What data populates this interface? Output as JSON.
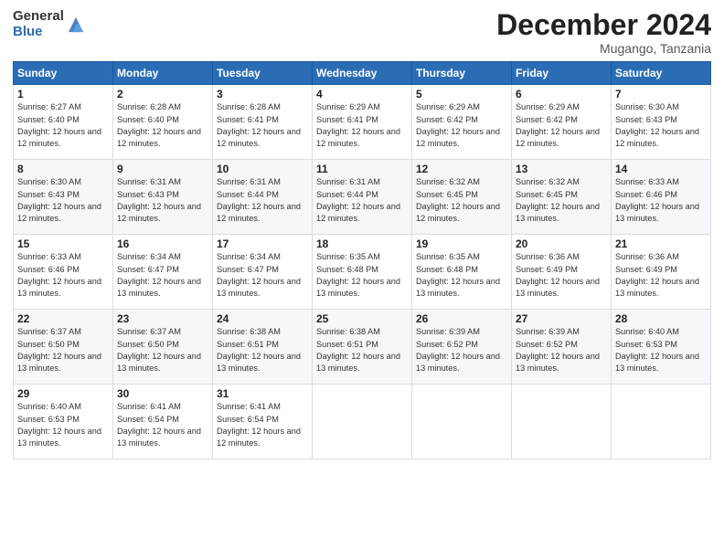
{
  "logo": {
    "general": "General",
    "blue": "Blue"
  },
  "title": "December 2024",
  "location": "Mugango, Tanzania",
  "days_of_week": [
    "Sunday",
    "Monday",
    "Tuesday",
    "Wednesday",
    "Thursday",
    "Friday",
    "Saturday"
  ],
  "weeks": [
    [
      {
        "day": "1",
        "sunrise": "6:27 AM",
        "sunset": "6:40 PM",
        "daylight": "12 hours and 12 minutes."
      },
      {
        "day": "2",
        "sunrise": "6:28 AM",
        "sunset": "6:40 PM",
        "daylight": "12 hours and 12 minutes."
      },
      {
        "day": "3",
        "sunrise": "6:28 AM",
        "sunset": "6:41 PM",
        "daylight": "12 hours and 12 minutes."
      },
      {
        "day": "4",
        "sunrise": "6:29 AM",
        "sunset": "6:41 PM",
        "daylight": "12 hours and 12 minutes."
      },
      {
        "day": "5",
        "sunrise": "6:29 AM",
        "sunset": "6:42 PM",
        "daylight": "12 hours and 12 minutes."
      },
      {
        "day": "6",
        "sunrise": "6:29 AM",
        "sunset": "6:42 PM",
        "daylight": "12 hours and 12 minutes."
      },
      {
        "day": "7",
        "sunrise": "6:30 AM",
        "sunset": "6:43 PM",
        "daylight": "12 hours and 12 minutes."
      }
    ],
    [
      {
        "day": "8",
        "sunrise": "6:30 AM",
        "sunset": "6:43 PM",
        "daylight": "12 hours and 12 minutes."
      },
      {
        "day": "9",
        "sunrise": "6:31 AM",
        "sunset": "6:43 PM",
        "daylight": "12 hours and 12 minutes."
      },
      {
        "day": "10",
        "sunrise": "6:31 AM",
        "sunset": "6:44 PM",
        "daylight": "12 hours and 12 minutes."
      },
      {
        "day": "11",
        "sunrise": "6:31 AM",
        "sunset": "6:44 PM",
        "daylight": "12 hours and 12 minutes."
      },
      {
        "day": "12",
        "sunrise": "6:32 AM",
        "sunset": "6:45 PM",
        "daylight": "12 hours and 12 minutes."
      },
      {
        "day": "13",
        "sunrise": "6:32 AM",
        "sunset": "6:45 PM",
        "daylight": "12 hours and 13 minutes."
      },
      {
        "day": "14",
        "sunrise": "6:33 AM",
        "sunset": "6:46 PM",
        "daylight": "12 hours and 13 minutes."
      }
    ],
    [
      {
        "day": "15",
        "sunrise": "6:33 AM",
        "sunset": "6:46 PM",
        "daylight": "12 hours and 13 minutes."
      },
      {
        "day": "16",
        "sunrise": "6:34 AM",
        "sunset": "6:47 PM",
        "daylight": "12 hours and 13 minutes."
      },
      {
        "day": "17",
        "sunrise": "6:34 AM",
        "sunset": "6:47 PM",
        "daylight": "12 hours and 13 minutes."
      },
      {
        "day": "18",
        "sunrise": "6:35 AM",
        "sunset": "6:48 PM",
        "daylight": "12 hours and 13 minutes."
      },
      {
        "day": "19",
        "sunrise": "6:35 AM",
        "sunset": "6:48 PM",
        "daylight": "12 hours and 13 minutes."
      },
      {
        "day": "20",
        "sunrise": "6:36 AM",
        "sunset": "6:49 PM",
        "daylight": "12 hours and 13 minutes."
      },
      {
        "day": "21",
        "sunrise": "6:36 AM",
        "sunset": "6:49 PM",
        "daylight": "12 hours and 13 minutes."
      }
    ],
    [
      {
        "day": "22",
        "sunrise": "6:37 AM",
        "sunset": "6:50 PM",
        "daylight": "12 hours and 13 minutes."
      },
      {
        "day": "23",
        "sunrise": "6:37 AM",
        "sunset": "6:50 PM",
        "daylight": "12 hours and 13 minutes."
      },
      {
        "day": "24",
        "sunrise": "6:38 AM",
        "sunset": "6:51 PM",
        "daylight": "12 hours and 13 minutes."
      },
      {
        "day": "25",
        "sunrise": "6:38 AM",
        "sunset": "6:51 PM",
        "daylight": "12 hours and 13 minutes."
      },
      {
        "day": "26",
        "sunrise": "6:39 AM",
        "sunset": "6:52 PM",
        "daylight": "12 hours and 13 minutes."
      },
      {
        "day": "27",
        "sunrise": "6:39 AM",
        "sunset": "6:52 PM",
        "daylight": "12 hours and 13 minutes."
      },
      {
        "day": "28",
        "sunrise": "6:40 AM",
        "sunset": "6:53 PM",
        "daylight": "12 hours and 13 minutes."
      }
    ],
    [
      {
        "day": "29",
        "sunrise": "6:40 AM",
        "sunset": "6:53 PM",
        "daylight": "12 hours and 13 minutes."
      },
      {
        "day": "30",
        "sunrise": "6:41 AM",
        "sunset": "6:54 PM",
        "daylight": "12 hours and 13 minutes."
      },
      {
        "day": "31",
        "sunrise": "6:41 AM",
        "sunset": "6:54 PM",
        "daylight": "12 hours and 12 minutes."
      },
      null,
      null,
      null,
      null
    ]
  ]
}
